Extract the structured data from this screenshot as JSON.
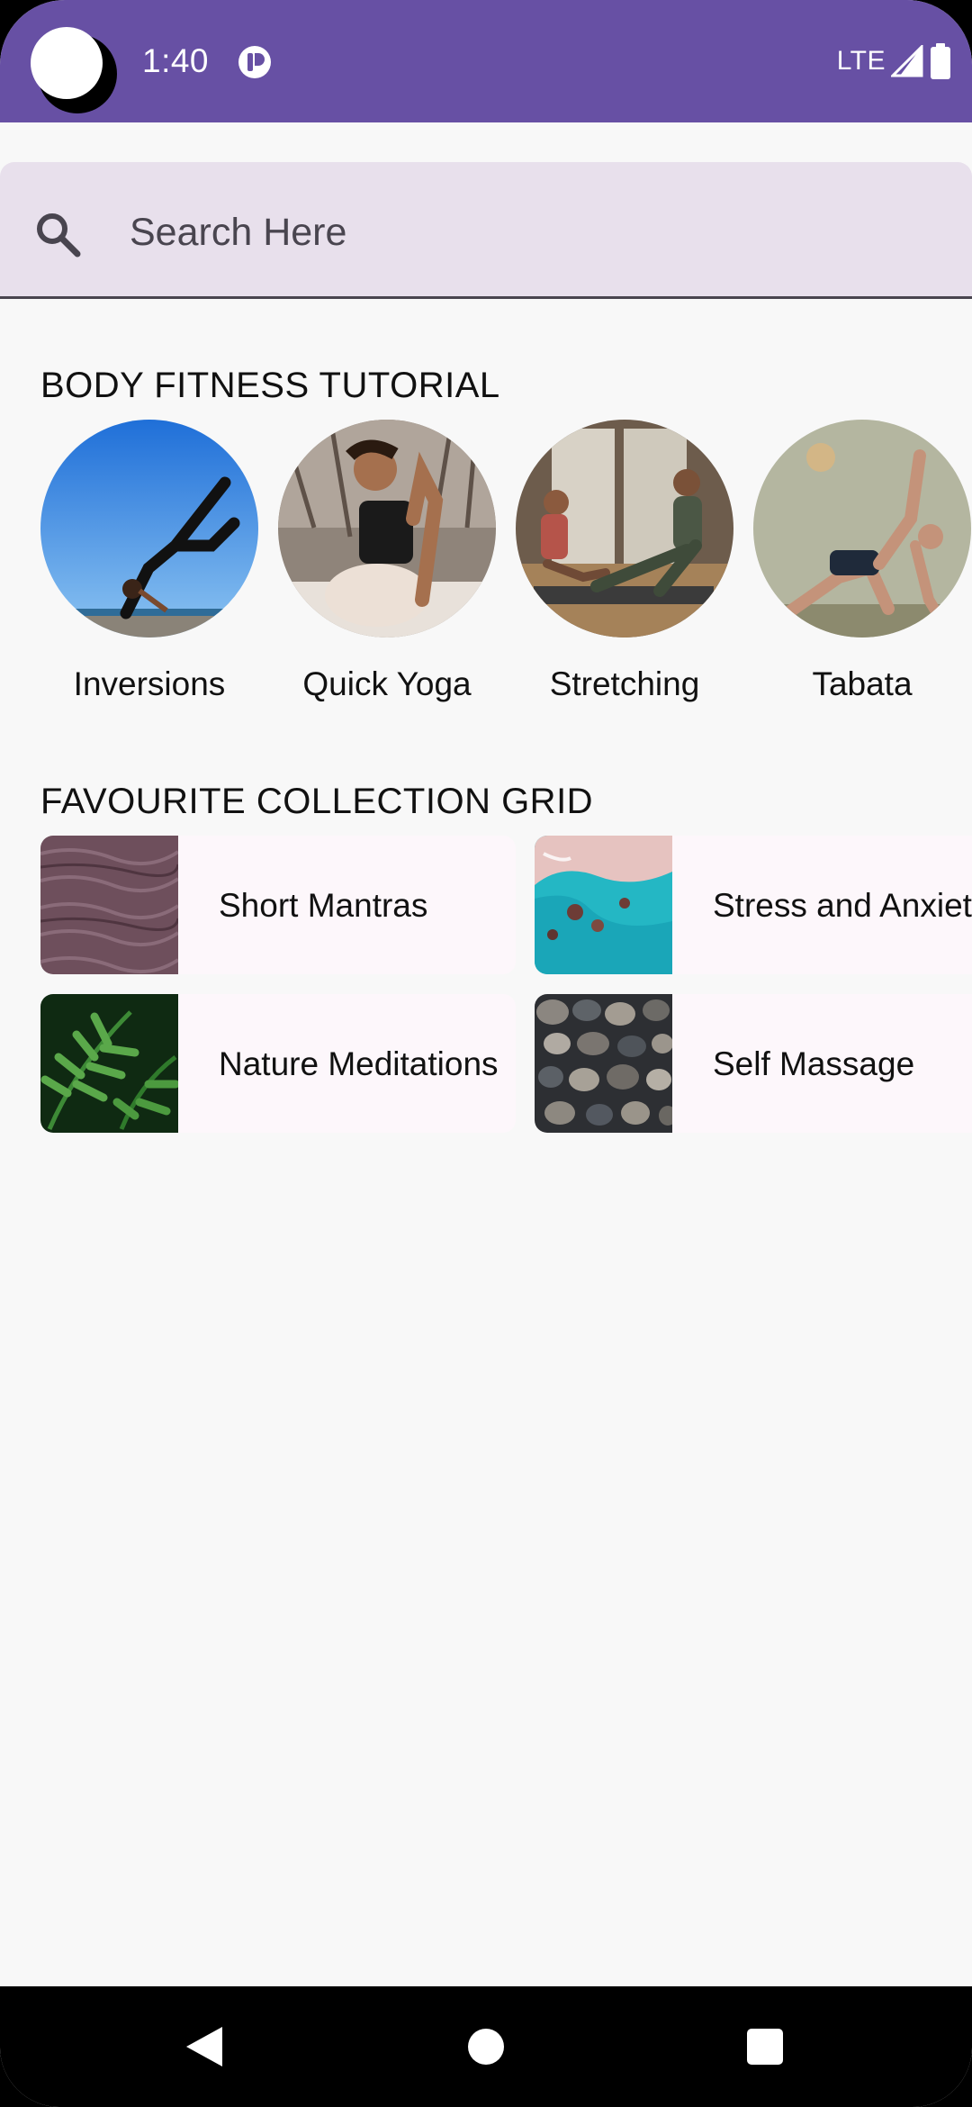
{
  "status_bar": {
    "time": "1:40",
    "network": "LTE"
  },
  "search": {
    "placeholder": "Search Here"
  },
  "sections": {
    "tutorials_title": "BODY FITNESS TUTORIAL",
    "collection_title": "FAVOURITE COLLECTION GRID"
  },
  "tutorials": [
    {
      "label": "Inversions"
    },
    {
      "label": "Quick Yoga"
    },
    {
      "label": "Stretching"
    },
    {
      "label": "Tabata"
    }
  ],
  "collections": [
    {
      "label": "Short Mantras"
    },
    {
      "label": "Stress and Anxiety"
    },
    {
      "label": "Nature Meditations"
    },
    {
      "label": "Self Massage"
    }
  ],
  "colors": {
    "primary": "#6750a4",
    "search_background": "#e8e0ec",
    "card_background": "#fdf7fb",
    "page_background": "#f8f8f8"
  },
  "icons": {
    "search": "search-icon",
    "app_notification": "app-notification-icon",
    "signal": "signal-icon",
    "battery": "battery-icon",
    "back": "back-icon",
    "home": "home-icon",
    "recents": "recents-icon"
  }
}
